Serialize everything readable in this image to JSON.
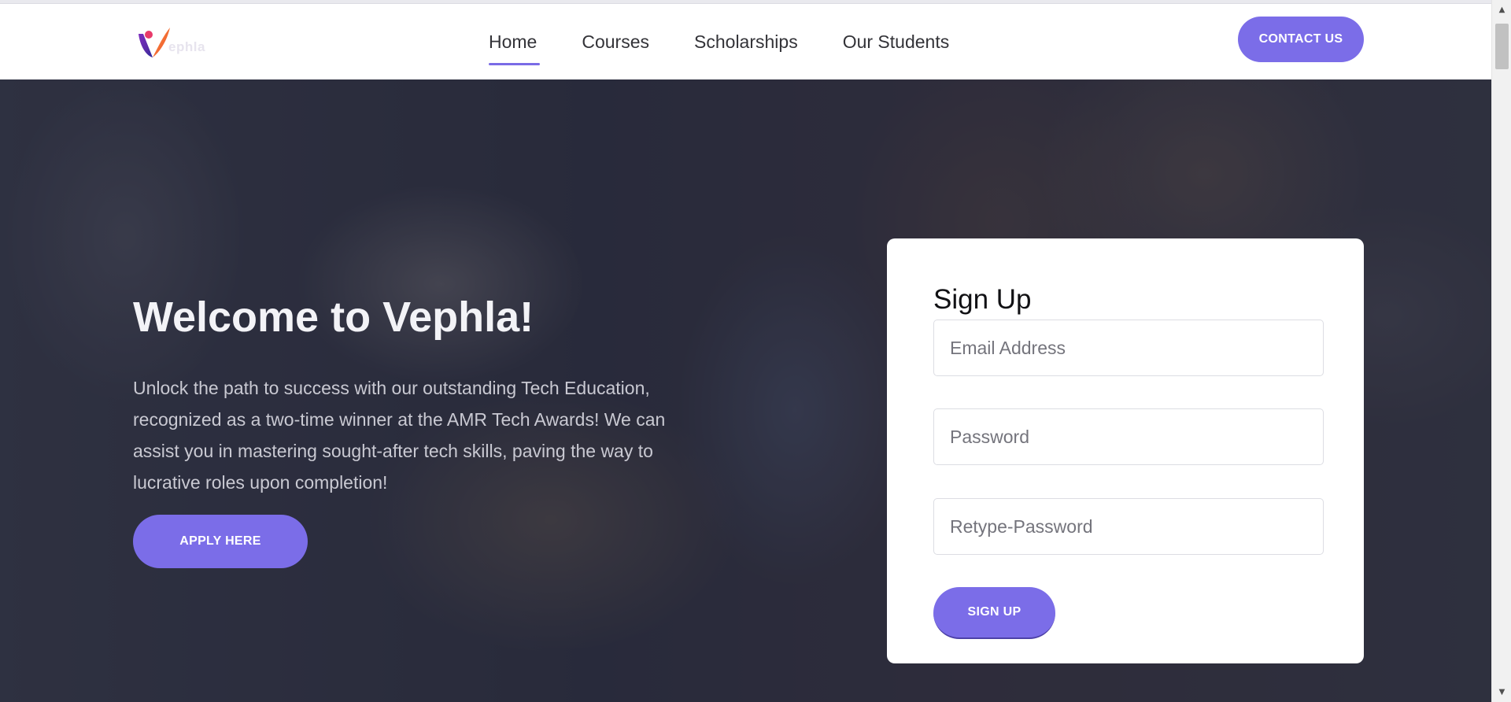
{
  "brand": {
    "logo_text": "ephla",
    "accent_color": "#7b6de8"
  },
  "nav": {
    "items": [
      {
        "label": "Home",
        "active": true
      },
      {
        "label": "Courses",
        "active": false
      },
      {
        "label": "Scholarships",
        "active": false
      },
      {
        "label": "Our Students",
        "active": false
      }
    ],
    "contact_label": "CONTACT US"
  },
  "hero": {
    "title": "Welcome to Vephla!",
    "description": "Unlock the path to success with our outstanding Tech Education, recognized as a two-time winner at the AMR Tech Awards! We can assist you in mastering sought-after tech skills, paving the way to lucrative roles upon completion!",
    "apply_label": "APPLY HERE"
  },
  "signup": {
    "title": "Sign Up",
    "email_placeholder": "Email Address",
    "password_placeholder": "Password",
    "retype_placeholder": "Retype-Password",
    "submit_label": "SIGN UP"
  },
  "icons": {
    "logo": "vephla-logo-icon",
    "scroll_up": "arrow-up-icon",
    "scroll_down": "arrow-down-icon"
  }
}
